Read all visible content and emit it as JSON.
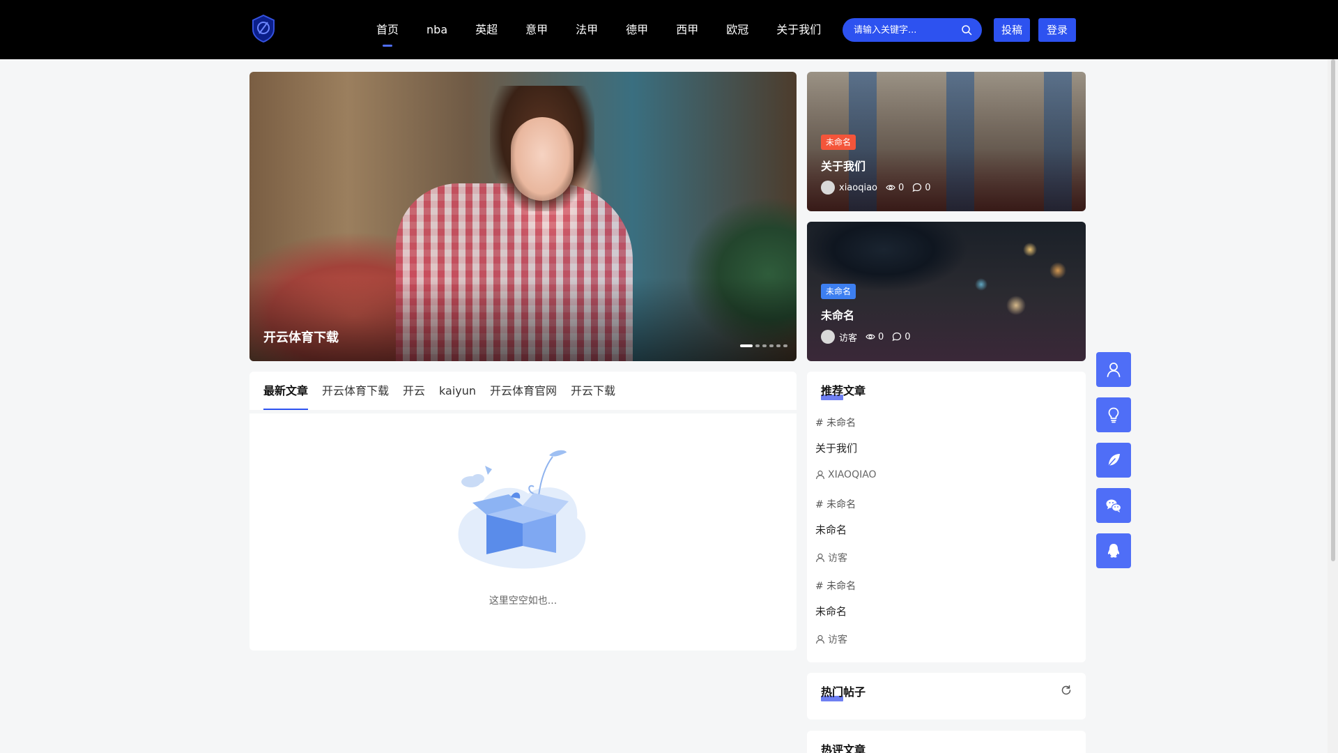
{
  "header": {
    "nav": [
      "首页",
      "nba",
      "英超",
      "意甲",
      "法甲",
      "德甲",
      "西甲",
      "欧冠",
      "关于我们"
    ],
    "search_placeholder": "请输入关键字...",
    "submit_label": "投稿",
    "login_label": "登录"
  },
  "hero": {
    "title": "开云体育下载",
    "slide_count": 6,
    "active_slide": 1
  },
  "side_cards": [
    {
      "tag": "未命名",
      "title": "关于我们",
      "author": "xiaoqiao",
      "views": "0",
      "comments": "0"
    },
    {
      "tag": "未命名",
      "title": "未命名",
      "author": "访客",
      "views": "0",
      "comments": "0"
    }
  ],
  "latest": {
    "tabs": [
      "最新文章",
      "开云体育下载",
      "开云",
      "kaiyun",
      "开云体育官网",
      "开云下载"
    ],
    "empty_text": "这里空空如也..."
  },
  "recommend": {
    "title": "推荐文章",
    "items": [
      {
        "category": "# 未命名",
        "title": "关于我们",
        "author": "XIAOQIAO"
      },
      {
        "category": "# 未命名",
        "title": "未命名",
        "author": "访客"
      },
      {
        "category": "# 未命名",
        "title": "未命名",
        "author": "访客"
      }
    ]
  },
  "hot_posts": {
    "title": "热门帖子"
  },
  "hot_comments": {
    "title": "热评文章"
  },
  "colors": {
    "primary": "#2d52f0",
    "float_button": "#4f6ef7",
    "tag_red": "#f4553a",
    "tag_blue": "#3d7ff0",
    "header_bg": "#000000"
  },
  "icons": {
    "float_buttons": [
      "user-icon",
      "lightbulb-icon",
      "feather-icon",
      "wechat-icon",
      "qq-icon"
    ]
  }
}
